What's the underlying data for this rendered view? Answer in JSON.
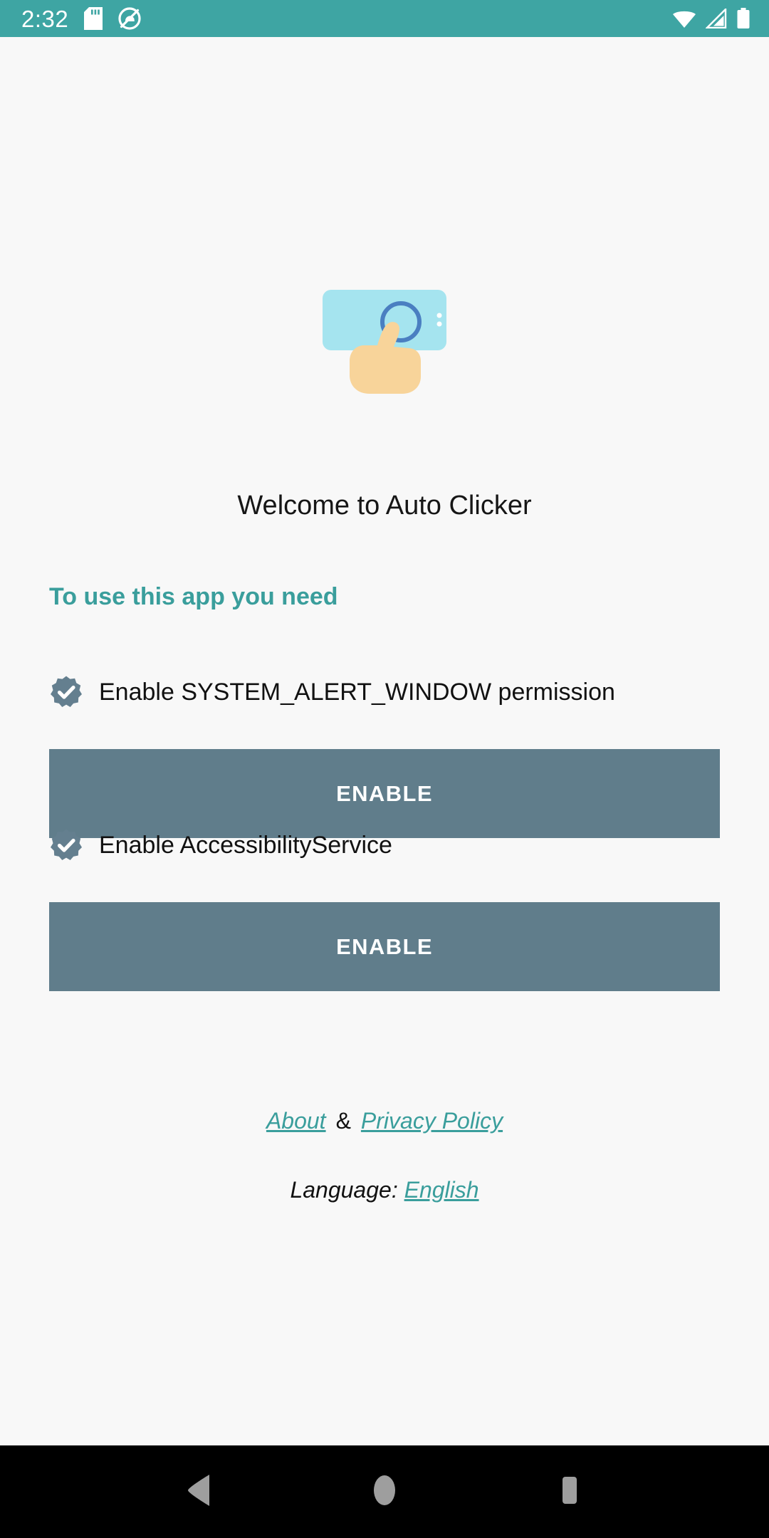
{
  "status_bar": {
    "time": "2:32",
    "background_color": "#3EA5A3",
    "left_icons": [
      "sd-card-icon",
      "data-saver-icon"
    ],
    "right_icons": [
      "wifi-icon",
      "cellular-signal-icon",
      "battery-icon"
    ]
  },
  "app": {
    "icon": "auto-clicker-hand-tap-icon",
    "welcome_title": "Welcome to Auto Clicker",
    "section_heading": "To use this app you need",
    "accent_color": "#3A9E9C",
    "button_color": "#607D8B",
    "background_color": "#F8F8F8"
  },
  "permissions": [
    {
      "icon": "verified-check-badge-icon",
      "label": "Enable SYSTEM_ALERT_WINDOW permission",
      "button_label": "ENABLE"
    },
    {
      "icon": "verified-check-badge-icon",
      "label": "Enable AccessibilityService",
      "button_label": "ENABLE"
    }
  ],
  "footer": {
    "about_label": "About",
    "separator": "&",
    "privacy_label": "Privacy Policy",
    "language_label": "Language:",
    "language_value": "English"
  },
  "nav_bar": {
    "back_label": "back-button",
    "home_label": "home-button",
    "recents_label": "recents-button",
    "background_color": "#000000",
    "icon_color": "#9E9E9E"
  }
}
